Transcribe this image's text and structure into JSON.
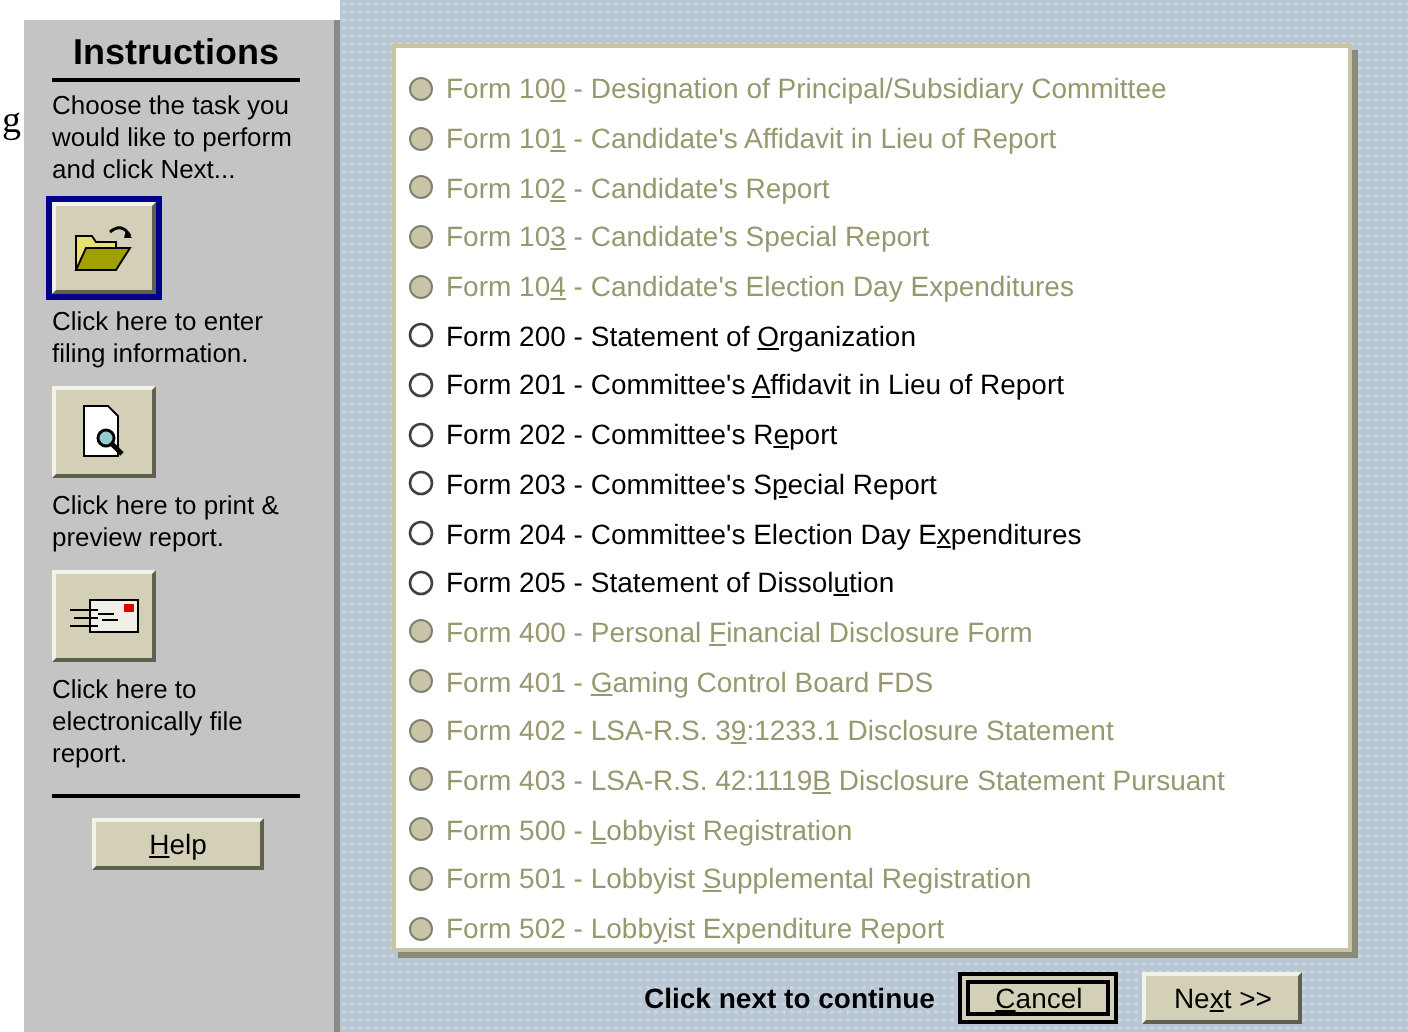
{
  "background_text": "g",
  "instructions": {
    "title": "Instructions",
    "intro": "Choose the task you would like to perform and click Next...",
    "tools": [
      {
        "kind": "enter",
        "focused": true,
        "caption": "Click here to enter filing information."
      },
      {
        "kind": "preview",
        "focused": false,
        "caption": "Click here to print & preview report."
      },
      {
        "kind": "efile",
        "focused": false,
        "caption": "Click here to electronically file report."
      }
    ],
    "help_button": {
      "key": "H",
      "after": "elp"
    }
  },
  "forms": [
    {
      "before": "Form 10",
      "key": "0",
      "after": " - Designation of Principal/Subsidiary Committee",
      "disabled": true,
      "selected": false
    },
    {
      "before": "Form 10",
      "key": "1",
      "after": " - Candidate's Affidavit in Lieu of Report",
      "disabled": true,
      "selected": false
    },
    {
      "before": "Form 10",
      "key": "2",
      "after": " - Candidate's Report",
      "disabled": true,
      "selected": false
    },
    {
      "before": "Form 10",
      "key": "3",
      "after": " - Candidate's Special Report",
      "disabled": true,
      "selected": false
    },
    {
      "before": "Form 10",
      "key": "4",
      "after": " - Candidate's Election Day Expenditures",
      "disabled": true,
      "selected": false
    },
    {
      "before": "Form 200 - Statement of ",
      "key": "O",
      "after": "rganization",
      "disabled": false,
      "selected": false
    },
    {
      "before": "Form 201 - Committee's ",
      "key": "A",
      "after": "ffidavit in Lieu of Report",
      "disabled": false,
      "selected": false
    },
    {
      "before": "Form 202 - Committee's R",
      "key": "e",
      "after": "port",
      "disabled": false,
      "selected": false
    },
    {
      "before": "Form 203 - Committee's S",
      "key": "p",
      "after": "ecial Report",
      "disabled": false,
      "selected": false
    },
    {
      "before": "Form 204 - Committee's Election Day E",
      "key": "x",
      "after": "penditures",
      "disabled": false,
      "selected": false
    },
    {
      "before": "Form 205 - Statement of Dissol",
      "key": "u",
      "after": "tion",
      "disabled": false,
      "selected": false
    },
    {
      "before": "Form 400 - Personal ",
      "key": "F",
      "after": "inancial Disclosure Form",
      "disabled": true,
      "selected": false
    },
    {
      "before": "Form 401 - ",
      "key": "G",
      "after": "aming Control Board FDS",
      "disabled": true,
      "selected": false
    },
    {
      "before": "Form 402 - LSA-R.S. 3",
      "key": "9",
      "after": ":1233.1 Disclosure Statement",
      "disabled": true,
      "selected": false
    },
    {
      "before": "Form 403 - LSA-R.S. 42:1119",
      "key": "B",
      "after": " Disclosure Statement Pursuant",
      "disabled": true,
      "selected": false
    },
    {
      "before": "Form 500 - ",
      "key": "L",
      "after": "obbyist Registration",
      "disabled": true,
      "selected": false
    },
    {
      "before": "Form 501 - Lobbyist ",
      "key": "S",
      "after": "upplemental Registration",
      "disabled": true,
      "selected": false
    },
    {
      "before": "Form 502 - Lobb",
      "key": "y",
      "after": "ist Expenditure Report",
      "disabled": true,
      "selected": false
    }
  ],
  "footer": {
    "hint": "Click next to continue",
    "buttons": [
      {
        "key": "C",
        "after": "ancel",
        "focused": true
      },
      {
        "before": "Ne",
        "key": "x",
        "after": "t >>",
        "focused": false
      }
    ]
  }
}
